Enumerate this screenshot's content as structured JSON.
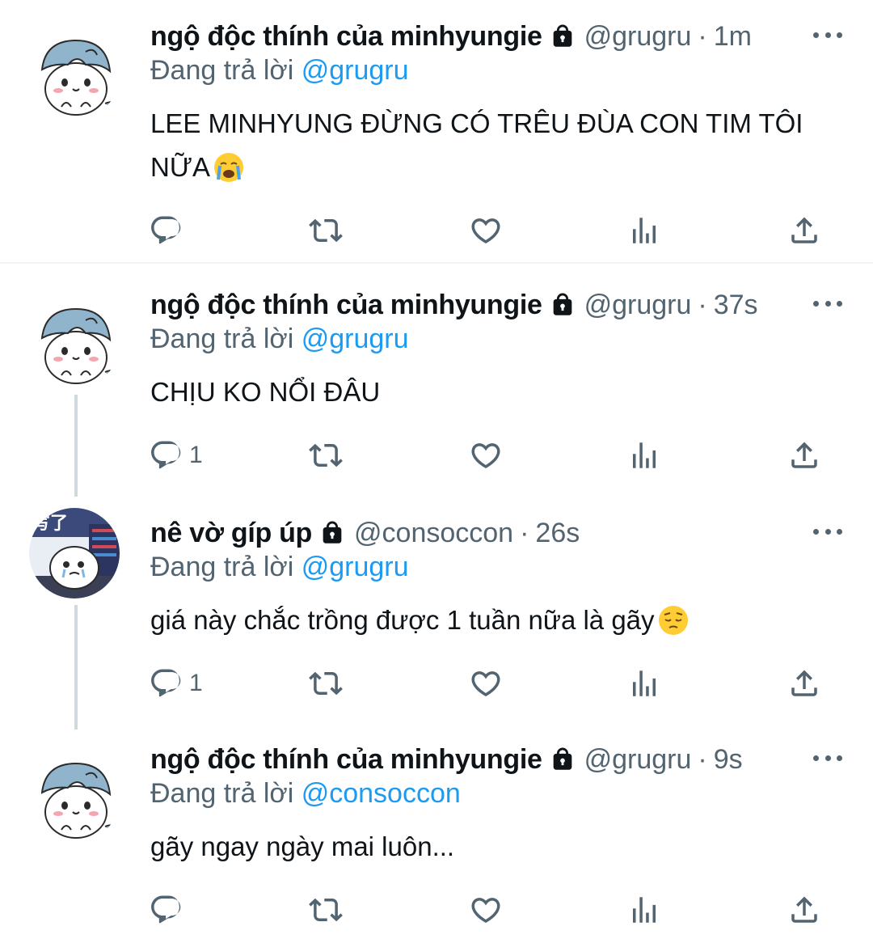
{
  "tweets": [
    {
      "display_name": "ngộ độc thính của minhyungie",
      "handle": "@grugru",
      "separator": "·",
      "time": "1m",
      "replying_prefix": "Đang trả lời",
      "replying_to": "@grugru",
      "text": "LEE MINHYUNG ĐỪNG CÓ TRÊU ĐÙA CON TIM TÔI NỮA",
      "emoji": "loudly-crying-face",
      "reply_count": "",
      "avatar": "blue-haired-cat-avatar"
    },
    {
      "display_name": "ngộ độc thính của minhyungie",
      "handle": "@grugru",
      "separator": "·",
      "time": "37s",
      "replying_prefix": "Đang trả lời",
      "replying_to": "@grugru",
      "text": "CHỊU KO NỔI ĐÂU",
      "emoji": "",
      "reply_count": "1",
      "avatar": "blue-haired-cat-avatar"
    },
    {
      "display_name": "nê vờ gíp úp",
      "handle": "@consoccon",
      "separator": "·",
      "time": "26s",
      "replying_prefix": "Đang trả lời",
      "replying_to": "@grugru",
      "text": "giá này chắc trồng được 1 tuần nữa là gãy",
      "emoji": "pensive-face",
      "reply_count": "1",
      "avatar": "crying-cat-at-computer-avatar"
    },
    {
      "display_name": "ngộ độc thính của minhyungie",
      "handle": "@grugru",
      "separator": "·",
      "time": "9s",
      "replying_prefix": "Đang trả lời",
      "replying_to": "@consoccon",
      "text": "gãy ngay ngày mai luôn...",
      "emoji": "",
      "reply_count": "",
      "avatar": "blue-haired-cat-avatar"
    }
  ],
  "icons": {
    "reply": "reply-icon",
    "retweet": "retweet-icon",
    "like": "heart-icon",
    "views": "analytics-icon",
    "share": "share-icon",
    "more": "more-icon",
    "protected": "lock-icon"
  },
  "colors": {
    "text": "#0f1419",
    "secondary": "#536471",
    "mention": "#1d9bf0",
    "thread_line": "#cfd9de",
    "divider": "#eff3f4"
  }
}
